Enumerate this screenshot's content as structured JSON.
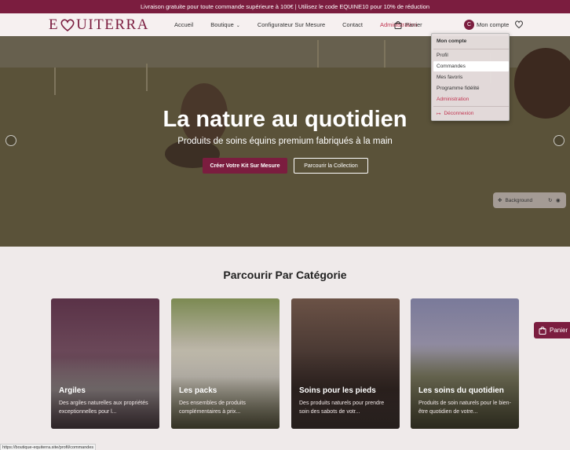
{
  "promo": {
    "text": "Livraison gratuite pour toute commande supérieure à 100€ | Utilisez le code EQUINE10 pour 10% de réduction"
  },
  "logo": {
    "text_left": "E",
    "text_right": "UITERRA",
    "brand_color": "#7b1d3f"
  },
  "nav": {
    "items": [
      {
        "label": "Accueil"
      },
      {
        "label": "Boutique"
      },
      {
        "label": "Configurateur Sur Mesure"
      },
      {
        "label": "Contact"
      },
      {
        "label": "Administration"
      }
    ],
    "cart_label": "Panier",
    "account_initial": "C",
    "account_label": "Mon compte",
    "icons": [
      "chevron-down-icon",
      "shopping-bag-icon",
      "heart-icon"
    ]
  },
  "dropdown": {
    "header": "Mon compte",
    "items": [
      {
        "label": "Profil"
      },
      {
        "label": "Commandes"
      },
      {
        "label": "Mes favoris"
      },
      {
        "label": "Programme fidélité"
      },
      {
        "label": "Administration"
      }
    ],
    "logout_label": "Déconnexion",
    "highlighted": "Commandes"
  },
  "hero": {
    "title": "La nature au quotidien",
    "subtitle": "Produits de soins équins premium fabriqués à la main",
    "primary_button": "Créer Votre Kit Sur Mesure",
    "secondary_button": "Parcourir la Collection"
  },
  "background_pill": {
    "label": "Background"
  },
  "categories": {
    "title": "Parcourir Par Catégorie",
    "cards": [
      {
        "title": "Argiles",
        "desc": "Des argiles naturelles aux propriétés exceptionnelles pour l..."
      },
      {
        "title": "Les packs",
        "desc": "Des ensembles de produits complémentaires à prix..."
      },
      {
        "title": "Soins pour les pieds",
        "desc": "Des produits naturels pour prendre soin des sabots de votr..."
      },
      {
        "title": "Les soins du quotidien",
        "desc": "Produits de soin naturels pour le bien-être quotidien de votre..."
      }
    ]
  },
  "floating_cart": {
    "label": "Panier"
  },
  "status_bar": {
    "url": "https://boutique-equiterra.site/profil/commandes"
  }
}
